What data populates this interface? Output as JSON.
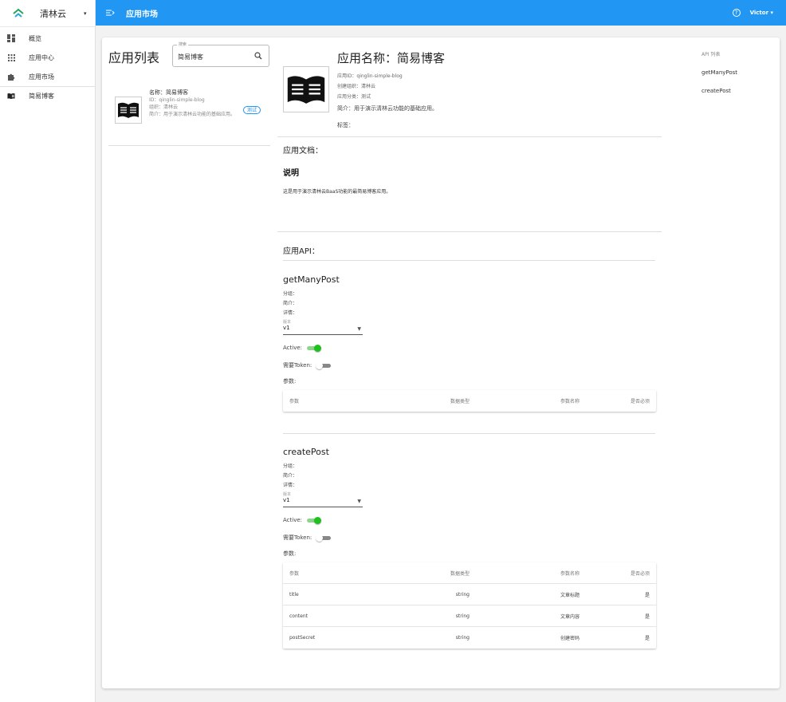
{
  "sidebar": {
    "brand": "清林云",
    "items": [
      {
        "label": "概览",
        "icon": "dashboard-icon"
      },
      {
        "label": "应用中心",
        "icon": "apps-grid-icon"
      },
      {
        "label": "应用市场",
        "icon": "puzzle-icon"
      },
      {
        "label": "简易博客",
        "icon": "book-icon"
      }
    ]
  },
  "topbar": {
    "title": "应用市场",
    "user": "Victor"
  },
  "list": {
    "title": "应用列表",
    "search": {
      "label": "搜索",
      "value": "简易博客"
    },
    "items": [
      {
        "name": "名称：简易博客",
        "id": "ID：qinglin-simple-blog",
        "org": "组织：清林云",
        "intro": "简介：用于演示清林云功能的基础应用。",
        "badge": "测试"
      }
    ]
  },
  "detail": {
    "title": "应用名称：简易博客",
    "app_id": "应用ID：qinglin-simple-blog",
    "org": "创建组织：清林云",
    "category": "应用分类：测试",
    "intro": "简介：用于演示清林云功能的基础应用。",
    "tags": "标签：",
    "doc_section": "应用文档：",
    "doc_heading": "说明",
    "doc_text": "这是用于演示清林云BaaS功能的最简易博客应用。",
    "api_section": "应用API："
  },
  "apis": [
    {
      "name": "getManyPost",
      "group": "分组：",
      "brief": "简介：",
      "detail": "详情：",
      "version_label": "版本",
      "version": "v1",
      "active_label": "Active:",
      "active": true,
      "token_label": "需要Token:",
      "token": false,
      "params_label": "参数:",
      "columns": [
        "参数",
        "数据类型",
        "参数名称",
        "是否必须"
      ],
      "rows": []
    },
    {
      "name": "createPost",
      "group": "分组：",
      "brief": "简介：",
      "detail": "详情：",
      "version_label": "版本",
      "version": "v1",
      "active_label": "Active:",
      "active": true,
      "token_label": "需要Token:",
      "token": false,
      "params_label": "参数:",
      "columns": [
        "参数",
        "数据类型",
        "参数名称",
        "是否必须"
      ],
      "rows": [
        [
          "title",
          "string",
          "文章标题",
          "是"
        ],
        [
          "content",
          "string",
          "文章内容",
          "是"
        ],
        [
          "postSecret",
          "string",
          "创建密码",
          "是"
        ]
      ]
    }
  ],
  "api_nav": {
    "heading": "API 列表",
    "links": [
      "getManyPost",
      "createPost"
    ]
  },
  "colors": {
    "primary": "#2196f3",
    "switch_on": "#1ec11e"
  }
}
